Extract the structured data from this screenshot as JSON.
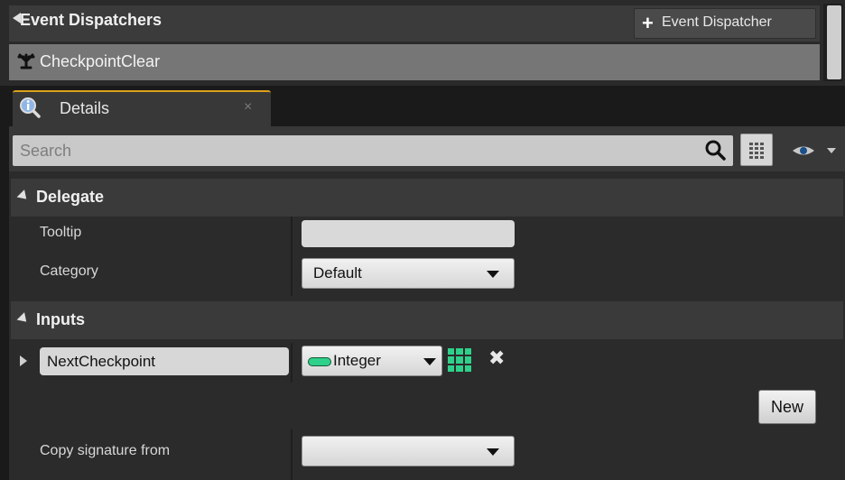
{
  "event_dispatchers": {
    "title": "Event Dispatchers",
    "add_button_label": "Event Dispatcher",
    "items": [
      {
        "label": "CheckpointClear",
        "icon": "event-dispatcher-icon"
      }
    ]
  },
  "tab": {
    "label": "Details",
    "icon": "info-magnifier-icon",
    "close_glyph": "×"
  },
  "search": {
    "placeholder": "Search",
    "value": ""
  },
  "delegate": {
    "title": "Delegate",
    "tooltip_label": "Tooltip",
    "tooltip_value": "",
    "category_label": "Category",
    "category_value": "Default"
  },
  "inputs": {
    "title": "Inputs",
    "params": [
      {
        "name": "NextCheckpoint",
        "type": "Integer",
        "type_color": "#2fd18a"
      }
    ],
    "new_button_label": "New",
    "copy_signature_label": "Copy signature from",
    "copy_signature_value": ""
  }
}
